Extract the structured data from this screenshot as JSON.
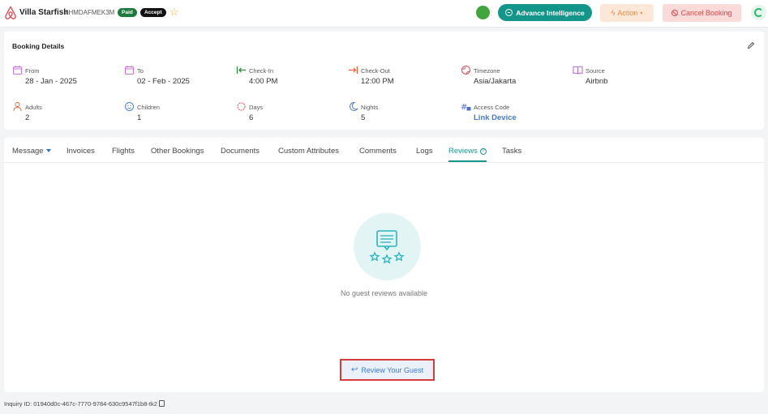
{
  "header": {
    "property_name": "Villa Starfish",
    "booking_code": "#HMDAFMEK3M",
    "badges": {
      "paid": "Paid",
      "accept": "Accept"
    },
    "buttons": {
      "advance_intelligence": "Advance Intelligence",
      "action": "Action",
      "cancel_booking": "Cancel Booking"
    },
    "colors": {
      "status_dot": "#3fa63b",
      "teal": "#14958a",
      "action": "#f08a3c",
      "cancel": "#e04646"
    },
    "icons": {
      "logo": "airbnb-icon",
      "favorite": "star-icon",
      "extension": "chrome-extension-icon"
    }
  },
  "booking_details": {
    "title": "Booking Details",
    "fields": {
      "from": {
        "label": "From",
        "value": "28 - Jan - 2025",
        "icon": "calendar-icon"
      },
      "to": {
        "label": "To",
        "value": "02 - Feb - 2025",
        "icon": "calendar-icon"
      },
      "check_in": {
        "label": "Check-In",
        "value": "4:00 PM",
        "icon": "check-in-arrow-icon"
      },
      "check_out": {
        "label": "Check-Out",
        "value": "12:00 PM",
        "icon": "check-out-arrow-icon"
      },
      "timezone": {
        "label": "Timezone",
        "value": "Asia/Jakarta",
        "icon": "globe-icon"
      },
      "source": {
        "label": "Source",
        "value": "Airbnb",
        "icon": "book-icon"
      },
      "adults": {
        "label": "Adults",
        "value": "2",
        "icon": "person-icon"
      },
      "children": {
        "label": "Children",
        "value": "1",
        "icon": "child-icon"
      },
      "days": {
        "label": "Days",
        "value": "6",
        "icon": "sun-icon"
      },
      "nights": {
        "label": "Nights",
        "value": "5",
        "icon": "moon-icon"
      },
      "access_code": {
        "label": "Access Code",
        "value": "Link Device",
        "icon": "hash-lock-icon"
      }
    }
  },
  "tabs": {
    "items": [
      "Message",
      "Invoices",
      "Flights",
      "Other Bookings",
      "Documents",
      "Custom Attributes",
      "Comments",
      "Logs",
      "Reviews",
      "Tasks"
    ],
    "active": "Reviews"
  },
  "reviews": {
    "empty_message": "No guest reviews available",
    "review_button": "Review Your Guest"
  },
  "footer": {
    "inquiry_id": "Inquiry ID: 01940d0c-467c-7770-9784-630c9547f1b8-tk2"
  }
}
